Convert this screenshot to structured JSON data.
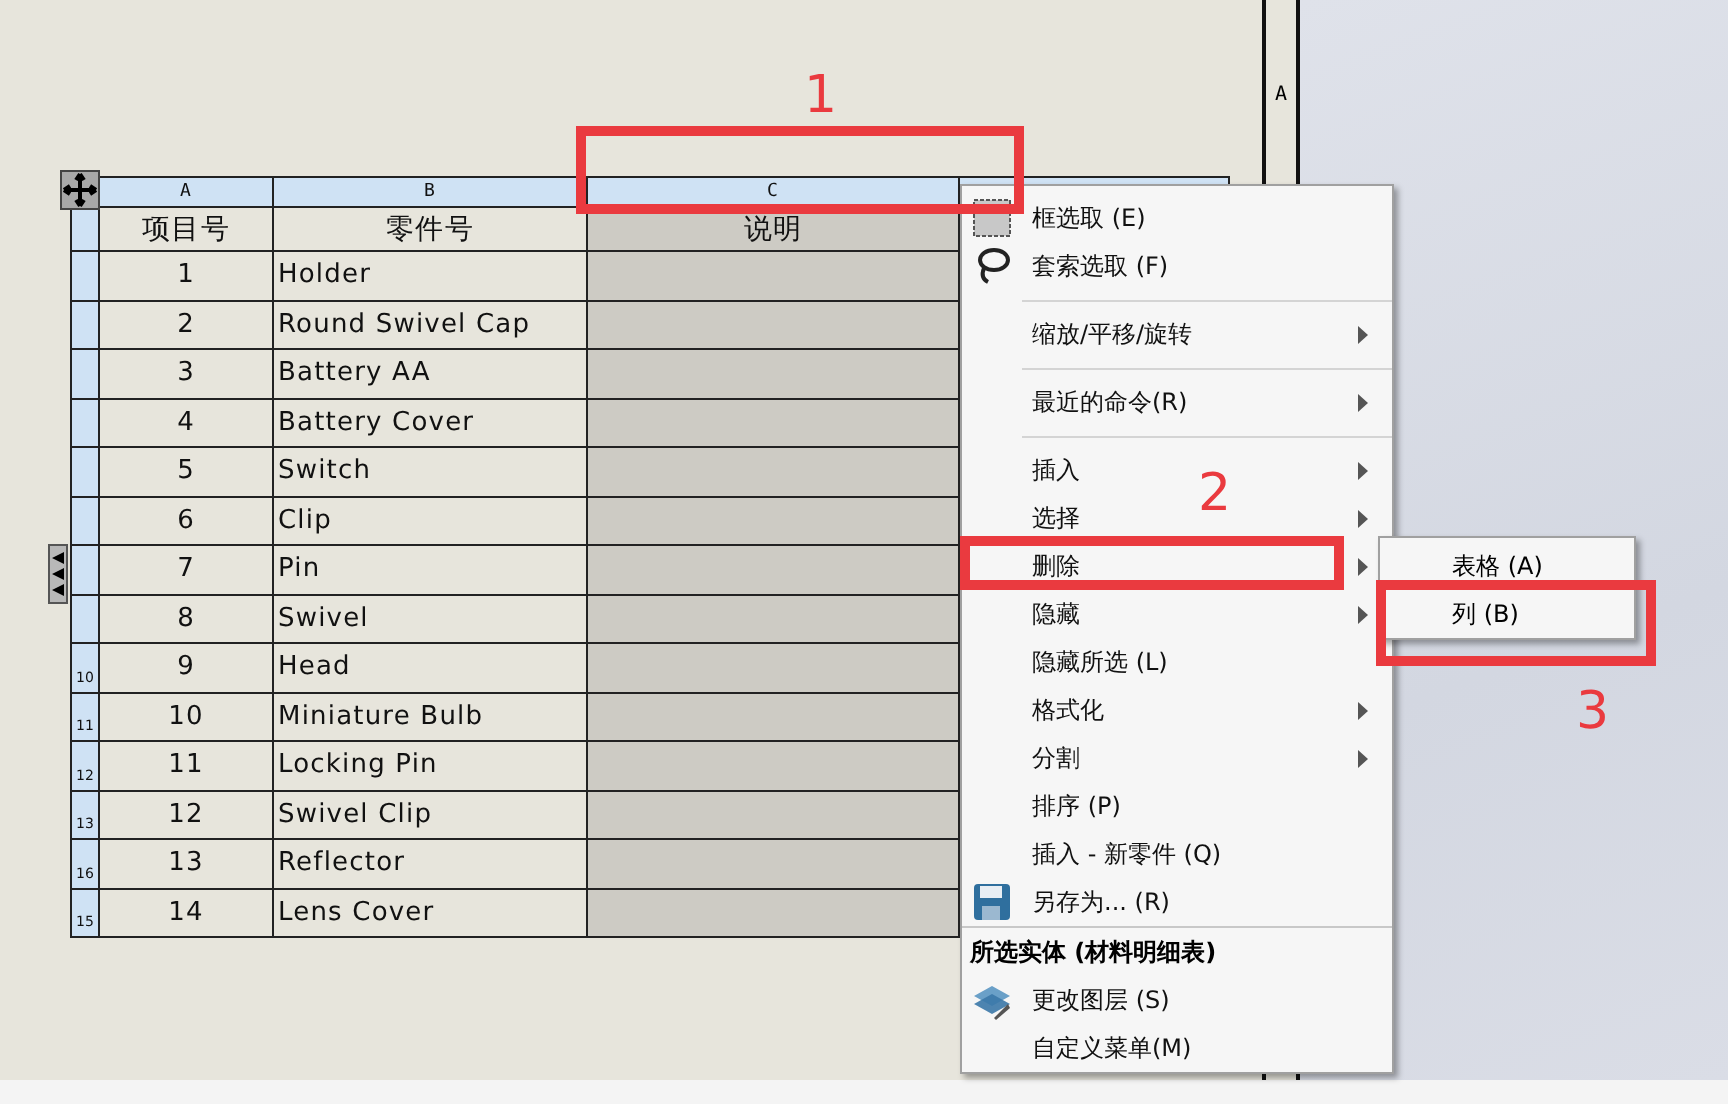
{
  "sheet": {
    "zone_label": "A"
  },
  "table": {
    "columns": [
      {
        "letter": "A",
        "title": "项目号",
        "selected": false
      },
      {
        "letter": "B",
        "title": "零件号",
        "selected": false
      },
      {
        "letter": "C",
        "title": "说明",
        "selected": true
      }
    ],
    "rows": [
      {
        "item": "1",
        "part": "Holder"
      },
      {
        "item": "2",
        "part": "Round Swivel Cap"
      },
      {
        "item": "3",
        "part": "Battery AA"
      },
      {
        "item": "4",
        "part": "Battery Cover"
      },
      {
        "item": "5",
        "part": "Switch"
      },
      {
        "item": "6",
        "part": "Clip"
      },
      {
        "item": "7",
        "part": "Pin"
      },
      {
        "item": "8",
        "part": "Swivel"
      },
      {
        "row_label": "10",
        "item": "9",
        "part": "Head"
      },
      {
        "row_label": "11",
        "item": "10",
        "part": "Miniature Bulb"
      },
      {
        "row_label": "12",
        "item": "11",
        "part": "Locking Pin"
      },
      {
        "row_label": "13",
        "item": "12",
        "part": "Swivel Clip"
      },
      {
        "row_label": "16",
        "item": "13",
        "part": "Reflector"
      },
      {
        "row_label": "15",
        "item": "14",
        "part": "Lens Cover"
      }
    ]
  },
  "context_menu": {
    "items": [
      {
        "kind": "item",
        "label": "框选取 (E)"
      },
      {
        "kind": "item",
        "label": "套索选取 (F)"
      },
      {
        "kind": "separator"
      },
      {
        "kind": "submenu",
        "label": "缩放/平移/旋转"
      },
      {
        "kind": "separator"
      },
      {
        "kind": "submenu",
        "label": "最近的命令(R)"
      },
      {
        "kind": "separator"
      },
      {
        "kind": "submenu",
        "label": "插入"
      },
      {
        "kind": "submenu",
        "label": "选择"
      },
      {
        "kind": "submenu",
        "label": "删除"
      },
      {
        "kind": "submenu",
        "label": "隐藏"
      },
      {
        "kind": "item",
        "label": "隐藏所选 (L)"
      },
      {
        "kind": "submenu",
        "label": "格式化"
      },
      {
        "kind": "submenu",
        "label": "分割"
      },
      {
        "kind": "item",
        "label": "排序 (P)"
      },
      {
        "kind": "item",
        "label": "插入 - 新零件 (Q)"
      },
      {
        "kind": "item",
        "label": "另存为... (R)"
      },
      {
        "kind": "heading",
        "label": "所选实体 (材料明细表)"
      },
      {
        "kind": "item",
        "label": "更改图层 (S)"
      },
      {
        "kind": "item",
        "label": "自定义菜单(M)"
      }
    ]
  },
  "submenu": {
    "items": [
      "表格 (A)",
      "列 (B)"
    ]
  },
  "annotations": [
    {
      "label": "1"
    },
    {
      "label": "2"
    },
    {
      "label": "3"
    }
  ]
}
